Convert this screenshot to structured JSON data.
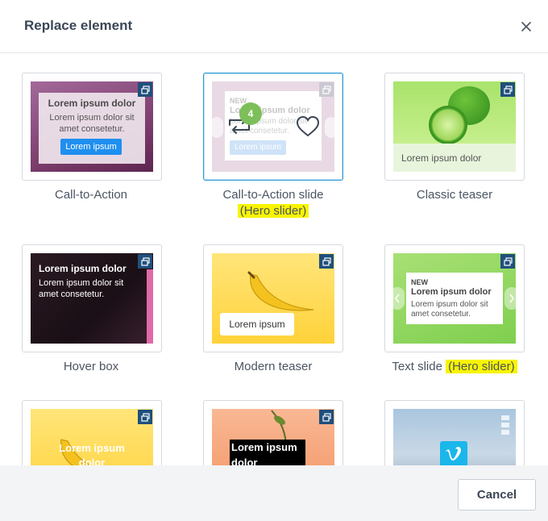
{
  "dialog": {
    "title": "Replace element",
    "cancel_label": "Cancel"
  },
  "elements": [
    {
      "label": "Call-to-Action",
      "thumb": {
        "title": "Lorem ipsum dolor",
        "body": "Lorem ipsum dolor sit amet consetetur.",
        "button": "Lorem ipsum"
      }
    },
    {
      "label": "Call-to-Action slide",
      "highlight": "(Hero slider)",
      "selected": true,
      "thumb": {
        "new": "NEW",
        "title": "Lorem ipsum dolor",
        "body": "Lorem ipsum dolor sit amet consetetur.",
        "button": "Lorem ipsum",
        "step": "4"
      }
    },
    {
      "label": "Classic teaser",
      "thumb": {
        "caption": "Lorem ipsum dolor"
      }
    },
    {
      "label": "Hover box",
      "thumb": {
        "title": "Lorem ipsum dolor",
        "body": "Lorem ipsum dolor sit amet consetetur."
      }
    },
    {
      "label": "Modern teaser",
      "thumb": {
        "caption": "Lorem ipsum"
      }
    },
    {
      "label": "Text slide",
      "highlight": "(Hero slider)",
      "thumb": {
        "new": "NEW",
        "title": "Lorem ipsum dolor",
        "body": "Lorem ipsum dolor sit amet consetetur."
      }
    },
    {
      "label": "",
      "thumb": {
        "title": "Lorem ipsum dolor"
      }
    },
    {
      "label": "",
      "thumb": {
        "title": "Lorem ipsum dolor"
      }
    },
    {
      "label": "",
      "thumb": {}
    }
  ],
  "icons": {
    "close": "close-icon",
    "badge": "layers-icon",
    "vimeo": "vimeo-icon"
  },
  "colors": {
    "accent": "#2d9ad6",
    "badge": "#1f4f7c",
    "highlight": "#f8f400",
    "button": "#1f8ff0"
  }
}
